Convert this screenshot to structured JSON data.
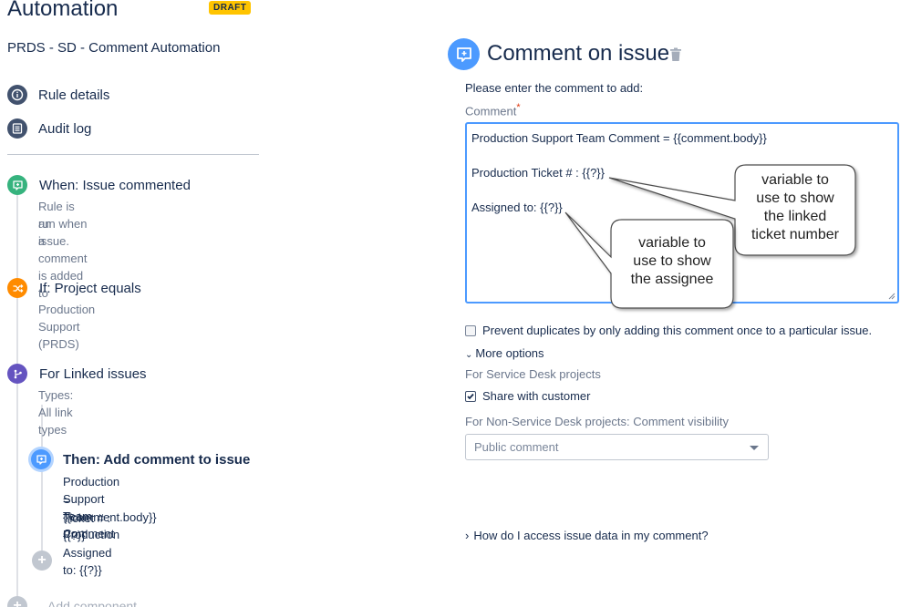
{
  "header": {
    "title": "Automation",
    "badge": "DRAFT"
  },
  "rule": {
    "name": "PRDS - SD - Comment Automation"
  },
  "nav": {
    "rule_details": "Rule details",
    "audit_log": "Audit log"
  },
  "steps": {
    "trigger": {
      "title": "When: Issue commented",
      "desc_line1": "Rule is run when a comment is added to",
      "desc_line2": "an issue."
    },
    "condition": {
      "title": "If: Project equals",
      "desc": "Production Support (PRDS)"
    },
    "branch": {
      "title": "For Linked issues",
      "desc": "Types: All link types"
    },
    "action": {
      "title": "Then: Add comment to issue",
      "desc_line1": "Production Support Team Comment",
      "desc_line2": "= {{comment.body}} Production",
      "desc_line3": "Ticket # : {{?}} Assigned to: {{?}}"
    },
    "add_component": "Add component"
  },
  "editor": {
    "title": "Comment on issue",
    "prompt": "Please enter the comment to add:",
    "field_label": "Comment",
    "required_mark": "*",
    "comment_lines": [
      "Production Support Team Comment = {{comment.body}}",
      "",
      "Production Ticket # : {{?}}",
      "",
      "Assigned to: {{?}}"
    ],
    "prevent_duplicates": {
      "label": "Prevent duplicates by only adding this comment once to a particular issue.",
      "checked": false
    },
    "more_options": "More options",
    "service_desk_label": "For Service Desk projects",
    "share_with_customer": {
      "label": "Share with customer",
      "checked": true
    },
    "non_sd_label": "For Non-Service Desk projects: Comment visibility",
    "visibility_select": {
      "value": "Public comment"
    },
    "help_link": "How do I access issue data in my comment?"
  },
  "callouts": {
    "linked": {
      "line1": "variable to",
      "line2": "use to show",
      "line3": "the linked",
      "line4": "ticket number"
    },
    "assignee": {
      "line1": "variable to",
      "line2": "use to show",
      "line3": "the assignee"
    }
  },
  "colors": {
    "trigger": "#36b37e",
    "condition": "#ff8b00",
    "branch": "#6554c0",
    "action": "#4c9aff",
    "badge": "#ffc400"
  }
}
